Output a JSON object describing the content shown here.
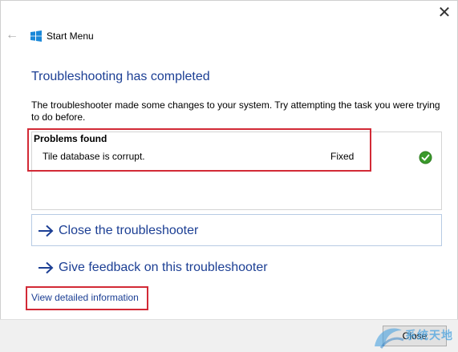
{
  "window": {
    "title": "Start Menu",
    "close_glyph": "✕",
    "back_glyph": "←"
  },
  "main": {
    "heading": "Troubleshooting has completed",
    "description": "The troubleshooter made some changes to your system. Try attempting the task you were trying to do before.",
    "problems_header": "Problems found",
    "problems": [
      {
        "name": "Tile database is corrupt.",
        "status": "Fixed",
        "icon": "check-circle-icon"
      }
    ]
  },
  "actions": {
    "close_troubleshooter": "Close the troubleshooter",
    "give_feedback": "Give feedback on this troubleshooter"
  },
  "links": {
    "view_details": "View detailed information"
  },
  "footer": {
    "close_label": "Close"
  },
  "watermark": {
    "text": "系统天地"
  },
  "colors": {
    "link_blue": "#1c3f94",
    "highlight_red": "#d22a36",
    "check_green": "#3a9a2b",
    "windows_blue": "#1a88d8"
  }
}
